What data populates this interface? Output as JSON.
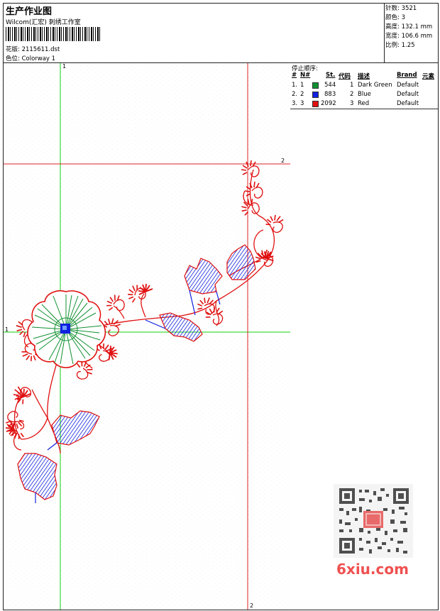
{
  "header": {
    "title": "生产作业图",
    "subtitle": "Wilcom(汇宏) 刺绣工作室",
    "design_label": "花版:",
    "design_value": "2115611.dst",
    "color_label": "色位:",
    "color_value": "Colorway 1"
  },
  "stats": [
    {
      "label": "针数:",
      "value": "3521"
    },
    {
      "label": "颜色:",
      "value": "3"
    },
    {
      "label": "高度:",
      "value": "132.1 mm"
    },
    {
      "label": "宽度:",
      "value": "106.6 mm"
    },
    {
      "label": "比例:",
      "value": "1.25"
    }
  ],
  "stop_sequence": {
    "title": "停止顺序:",
    "columns": [
      "#",
      "N#",
      "St.",
      "代码",
      "描述",
      "Brand",
      "元素"
    ],
    "rows": [
      {
        "n": "1.",
        "num": "1",
        "color": "#109030",
        "stitches": "544",
        "code": "1",
        "desc": "Dark Green",
        "brand": "Default"
      },
      {
        "n": "2.",
        "num": "2",
        "color": "#1020e0",
        "stitches": "883",
        "code": "2",
        "desc": "Blue",
        "brand": "Default"
      },
      {
        "n": "3.",
        "num": "3",
        "color": "#e01010",
        "stitches": "2092",
        "code": "3",
        "desc": "Red",
        "brand": "Default"
      }
    ]
  },
  "guides": {
    "green_v_label": "1",
    "green_h_label": "1",
    "red_h_label": "2",
    "red_v_label": "2",
    "green_color": "#10d010",
    "red_color": "#e02020"
  },
  "colors": {
    "red": "#e01010",
    "blue": "#1020e0",
    "green": "#109030"
  },
  "watermark": {
    "site": "6xiu.com"
  }
}
